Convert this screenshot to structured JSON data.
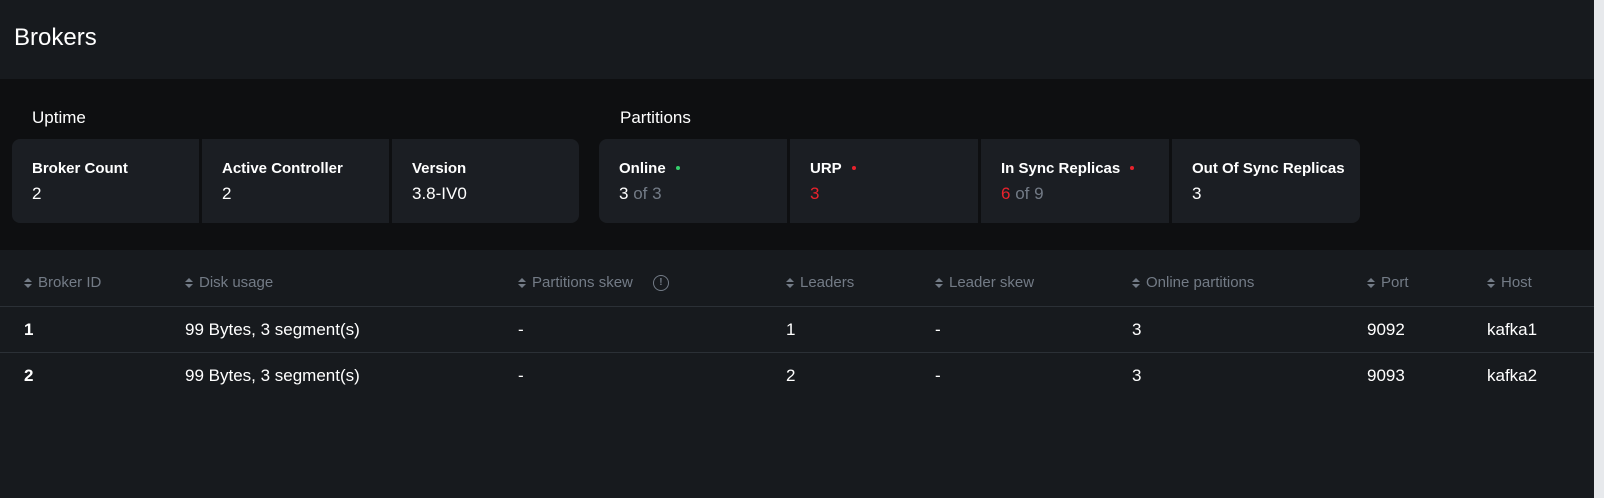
{
  "page": {
    "title": "Brokers"
  },
  "uptime": {
    "title": "Uptime",
    "cards": [
      {
        "label": "Broker Count",
        "value": "2"
      },
      {
        "label": "Active Controller",
        "value": "2"
      },
      {
        "label": "Version",
        "value": "3.8-IV0"
      }
    ]
  },
  "partitions": {
    "title": "Partitions",
    "online": {
      "label": "Online",
      "value": "3",
      "of_text": "of 3",
      "status_color": "#35d06c"
    },
    "urp": {
      "label": "URP",
      "value": "3",
      "status_color": "#e8222c"
    },
    "in_sync": {
      "label": "In Sync Replicas",
      "value": "6",
      "of_text": "of 9",
      "status_color": "#e8222c"
    },
    "out_of_sync": {
      "label": "Out Of Sync Replicas",
      "value": "3"
    }
  },
  "table": {
    "columns": [
      "Broker ID",
      "Disk usage",
      "Partitions skew",
      "Leaders",
      "Leader skew",
      "Online partitions",
      "Port",
      "Host"
    ],
    "rows": [
      [
        "1",
        "99 Bytes, 3 segment(s)",
        "-",
        "1",
        "-",
        "3",
        "9092",
        "kafka1"
      ],
      [
        "2",
        "99 Bytes, 3 segment(s)",
        "-",
        "2",
        "-",
        "3",
        "9093",
        "kafka2"
      ]
    ]
  },
  "colors": {
    "background": "#171a1e",
    "panel": "#0e0f11",
    "card": "#1b1e23",
    "muted_text": "#737b86",
    "alert": "#e8222c",
    "ok": "#35d06c"
  }
}
